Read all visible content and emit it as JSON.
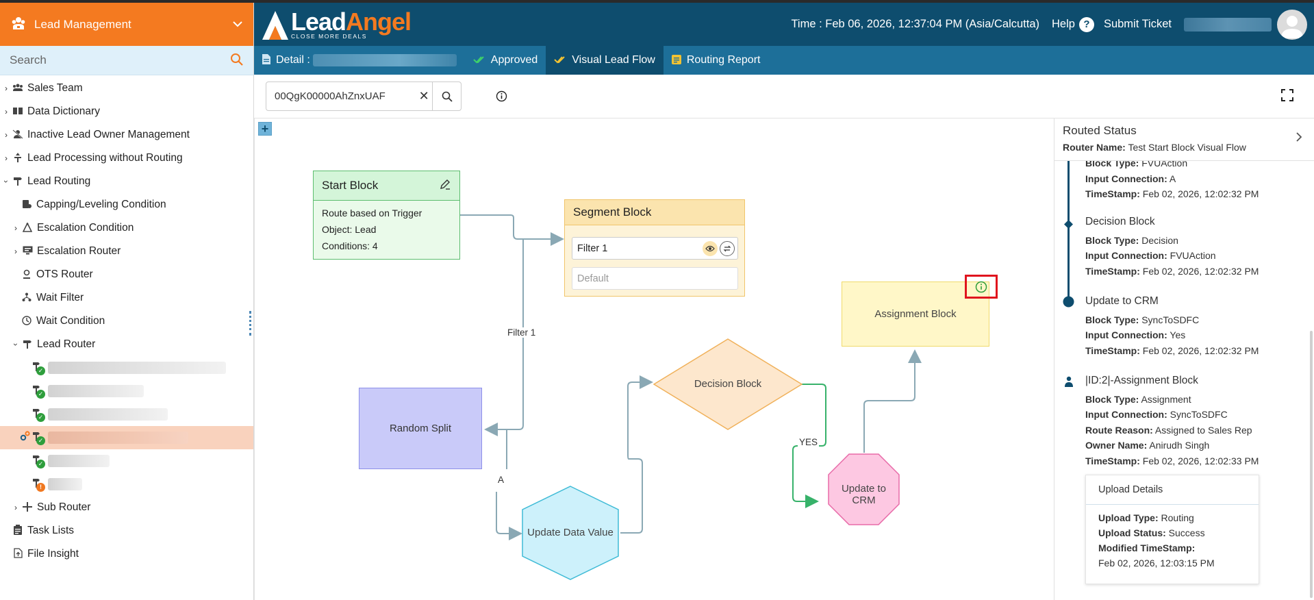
{
  "sidebar": {
    "title": "Lead Management",
    "search_placeholder": "Search",
    "items": [
      {
        "label": "Sales Team"
      },
      {
        "label": "Data Dictionary"
      },
      {
        "label": "Inactive Lead Owner Management"
      },
      {
        "label": "Lead Processing without Routing"
      },
      {
        "label": "Lead Routing"
      },
      {
        "label": "Capping/Leveling Condition"
      },
      {
        "label": "Escalation Condition"
      },
      {
        "label": "Escalation Router"
      },
      {
        "label": "OTS Router"
      },
      {
        "label": "Wait Filter"
      },
      {
        "label": "Wait Condition"
      },
      {
        "label": "Lead Router"
      },
      {
        "label": "Sub Router"
      },
      {
        "label": "Task Lists"
      },
      {
        "label": "File Insight"
      }
    ]
  },
  "topbar": {
    "logo_lead": "Lead",
    "logo_angel": "Angel",
    "logo_tagline": "CLOSE MORE DEALS",
    "time": "Time : Feb 06, 2026, 12:37:04 PM (Asia/Calcutta)",
    "help": "Help",
    "submit_ticket": "Submit Ticket"
  },
  "tabs": {
    "detail": "Detail :",
    "approved": "Approved",
    "visual_lead_flow": "Visual Lead Flow",
    "routing_report": "Routing Report"
  },
  "search": {
    "value": "00QgK00000AhZnxUAF"
  },
  "flow": {
    "start_title": "Start Block",
    "start_line1": "Route based on Trigger",
    "start_line2": "Object: Lead",
    "start_line3": "Conditions: 4",
    "segment_title": "Segment Block",
    "segment_filter": "Filter 1",
    "segment_default": "Default",
    "assignment": "Assignment Block",
    "decision": "Decision Block",
    "random_split": "Random Split",
    "update_data_value": "Update Data Value",
    "update_to_crm": "Update to CRM",
    "label_filter1": "Filter 1",
    "label_a": "A",
    "label_yes": "YES"
  },
  "routed_status": {
    "title": "Routed Status",
    "router_name_key": "Router Name:",
    "router_name": "Test Start Block Visual Flow",
    "entries": [
      {
        "name": "",
        "block_type": "FVUAction",
        "input_connection": "A",
        "timestamp": "Feb 02, 2026, 12:02:32 PM"
      },
      {
        "name": "Decision Block",
        "block_type": "Decision",
        "input_connection": "FVUAction",
        "timestamp": "Feb 02, 2026, 12:02:32 PM"
      },
      {
        "name": "Update to CRM",
        "block_type": "SyncToSDFC",
        "input_connection": "Yes",
        "timestamp": "Feb 02, 2026, 12:02:32 PM"
      },
      {
        "name": "|ID:2|-Assignment Block",
        "block_type": "Assignment",
        "input_connection": "SyncToSDFC",
        "route_reason": "Assigned to Sales Rep",
        "owner_name": "Anirudh Singh",
        "timestamp": "Feb 02, 2026, 12:02:33 PM"
      }
    ],
    "labels": {
      "block_type": "Block Type:",
      "input_connection": "Input Connection:",
      "timestamp": "TimeStamp:",
      "route_reason": "Route Reason:",
      "owner_name": "Owner Name:"
    },
    "upload": {
      "title": "Upload Details",
      "type_key": "Upload Type:",
      "type": "Routing",
      "status_key": "Upload Status:",
      "status": "Success",
      "modified_key": "Modified TimeStamp:",
      "modified": "Feb 02, 2026, 12:03:15 PM"
    }
  },
  "colors": {
    "sidebar_header": "#f47a20",
    "topbar": "#0e4d6e",
    "tabsbar": "#1d6f99",
    "selected_row": "#f9d2bd",
    "highlight_box": "#e0141e"
  }
}
